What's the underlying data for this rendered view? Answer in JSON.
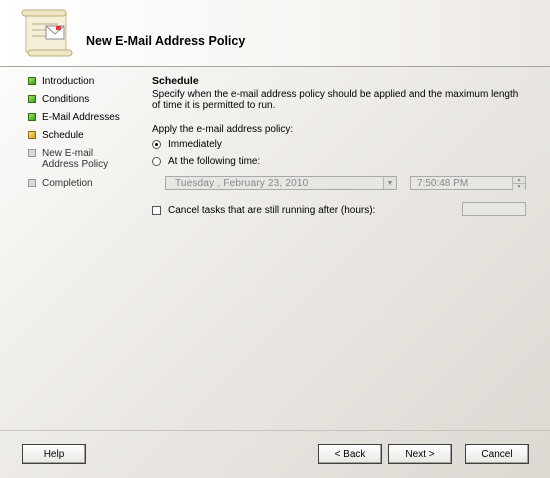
{
  "header": {
    "title": "New E-Mail Address Policy",
    "icon": "certificate-scroll-icon"
  },
  "steps": [
    {
      "label": "Introduction",
      "status": "done"
    },
    {
      "label": "Conditions",
      "status": "done"
    },
    {
      "label": "E-Mail Addresses",
      "status": "done"
    },
    {
      "label": "Schedule",
      "status": "current"
    },
    {
      "label": "New E-mail Address Policy",
      "status": "pending"
    },
    {
      "label": "Completion",
      "status": "pending"
    }
  ],
  "schedule": {
    "title": "Schedule",
    "description": "Specify when the e-mail address policy should be applied and the maximum length of time it is permitted to run.",
    "apply_label": "Apply the e-mail address policy:",
    "option_immediately": "Immediately",
    "option_following_time": "At the following time:",
    "selected_option": "Immediately",
    "date_value": "Tuesday  ,  February  23, 2010",
    "time_value": "7:50:48 PM",
    "cancel_tasks_label": "Cancel tasks that are still running after (hours):",
    "cancel_tasks_checked": false,
    "hours_value": ""
  },
  "buttons": {
    "help": "Help",
    "back": "< Back",
    "next": "Next >",
    "cancel": "Cancel"
  },
  "colors": {
    "step_done": "#3a9a1a",
    "step_current": "#d9a318",
    "step_pending": "#d8d8d8"
  }
}
